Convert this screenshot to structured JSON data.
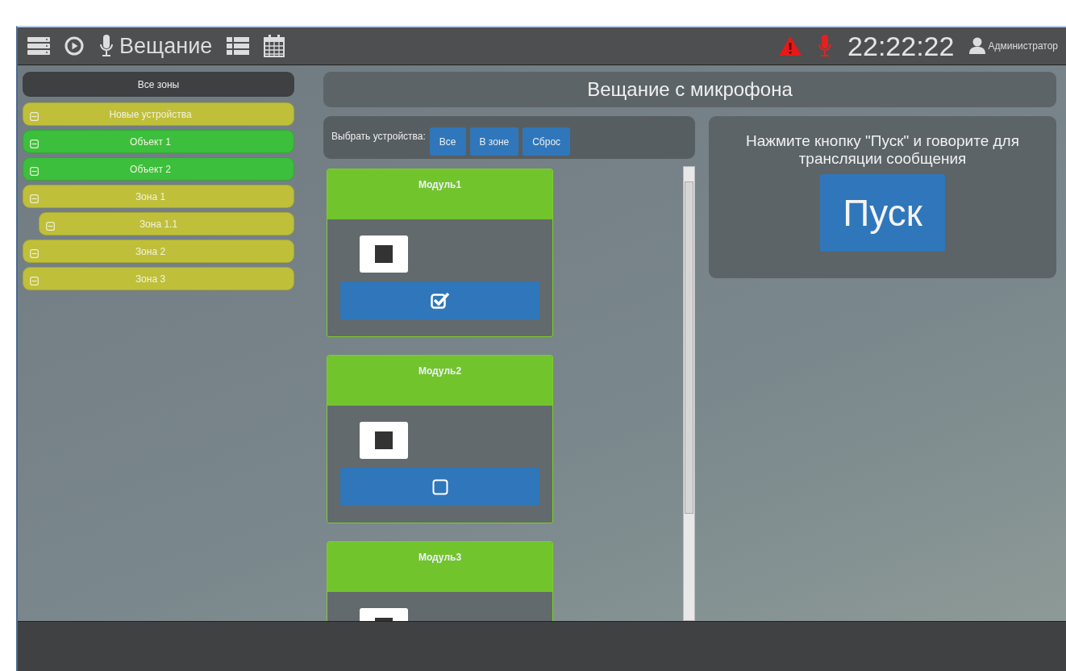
{
  "header": {
    "title": "Вещание",
    "clock": "22:22:22",
    "user": "Администратор",
    "alarm": true,
    "mic_alert": true
  },
  "sidebar": {
    "all_zones": "Все зоны",
    "zones": [
      {
        "label": "Новые устройства",
        "color": "#bfbf3a",
        "expanded": true
      },
      {
        "label": "Объект 1",
        "color": "#3cbf3c",
        "expanded": true
      },
      {
        "label": "Объект 2",
        "color": "#3cbf3c",
        "expanded": true
      },
      {
        "label": "Зона 1",
        "color": "#bfbf3a",
        "expanded": true,
        "children": [
          {
            "label": "Зона 1.1",
            "color": "#bfbf3a",
            "expanded": true
          }
        ]
      },
      {
        "label": "Зона 2",
        "color": "#bfbf3a",
        "expanded": true
      },
      {
        "label": "Зона 3",
        "color": "#bfbf3a",
        "expanded": true
      }
    ]
  },
  "panel_title": "Вещание с микрофона",
  "select_bar": {
    "label": "Выбрать устройства:",
    "buttons": [
      "Все",
      "В зоне",
      "Сброс"
    ]
  },
  "modules": [
    {
      "title": "Модуль1",
      "checked": true
    },
    {
      "title": "Модуль2",
      "checked": false
    },
    {
      "title": "Модуль3"
    }
  ],
  "broadcast": {
    "hint": "Нажмите кнопку \"Пуск\" и говорите для трансляции сообщения",
    "start": "Пуск"
  }
}
